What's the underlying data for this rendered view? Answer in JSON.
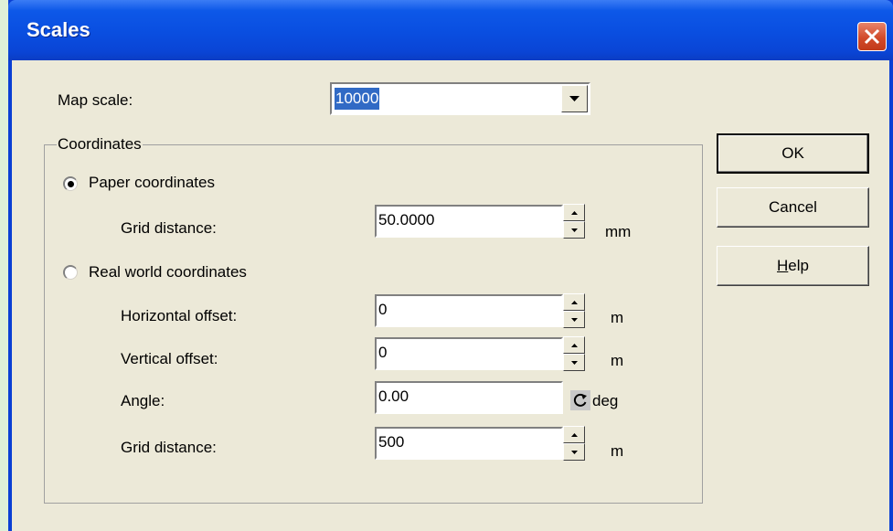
{
  "window": {
    "title": "Scales"
  },
  "map_scale": {
    "label": "Map scale:",
    "value": "10000"
  },
  "coordinates": {
    "group_label": "Coordinates",
    "paper": {
      "label": "Paper coordinates",
      "selected": true,
      "grid_distance": {
        "label": "Grid distance:",
        "value": "50.0000",
        "unit": "mm"
      }
    },
    "real_world": {
      "label": "Real world coordinates",
      "selected": false,
      "horizontal_offset": {
        "label": "Horizontal offset:",
        "value": "0",
        "unit": "m"
      },
      "vertical_offset": {
        "label": "Vertical offset:",
        "value": "0",
        "unit": "m"
      },
      "angle": {
        "label": "Angle:",
        "value": "0.00",
        "unit": "deg"
      },
      "grid_distance": {
        "label": "Grid distance:",
        "value": "500",
        "unit": "m"
      }
    }
  },
  "buttons": {
    "ok": "OK",
    "cancel": "Cancel",
    "help_mnemonic": "H",
    "help_rest": "elp"
  },
  "icons": {
    "close": "close-icon",
    "dropdown": "dropdown-arrow-icon",
    "spin_up": "spin-up-icon",
    "spin_down": "spin-down-icon",
    "rotate": "rotate-icon"
  },
  "colors": {
    "titlebar": "#0a4ee0",
    "dialog_face": "#ece9d8",
    "selection": "#316ac5",
    "close_button": "#d24a2a"
  }
}
